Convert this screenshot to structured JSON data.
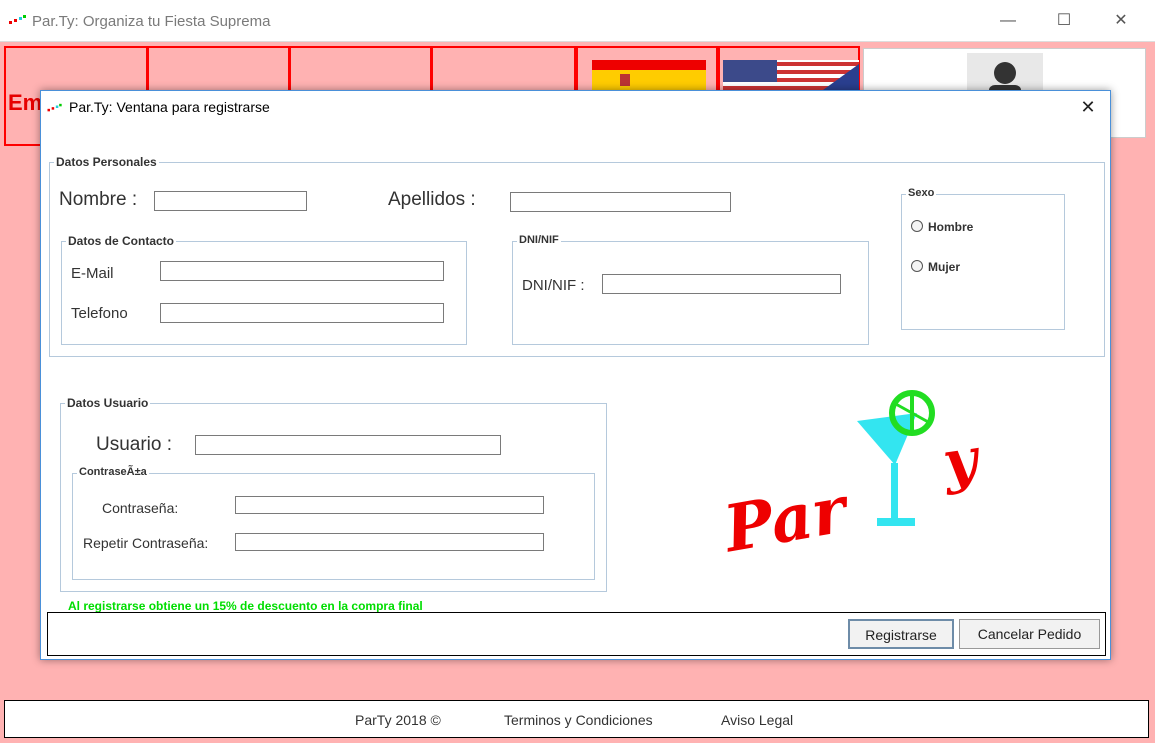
{
  "main_window": {
    "title": "Par.Ty: Organiza tu Fiesta Suprema",
    "top_buttons": [
      "Em",
      "",
      "",
      ""
    ]
  },
  "footer": {
    "copyright": "ParTy 2018 ©",
    "terms": "Terminos y Condiciones",
    "legal": "Aviso Legal"
  },
  "dialog": {
    "title": "Par.Ty: Ventana para registrarse",
    "personal": {
      "legend": "Datos Personales",
      "nombre_label": "Nombre :",
      "apellidos_label": "Apellidos :",
      "contacto": {
        "legend": "Datos de Contacto",
        "email_label": "E-Mail",
        "telefono_label": "Telefono"
      },
      "dni": {
        "legend": "DNI/NIF",
        "dni_label": "DNI/NIF :"
      },
      "sexo": {
        "legend": "Sexo",
        "hombre": "Hombre",
        "mujer": "Mujer"
      }
    },
    "usuario": {
      "legend": "Datos Usuario",
      "usuario_label": "Usuario :",
      "password_group": {
        "legend": "ContraseÃ±a",
        "password_label": "Contraseña:",
        "repeat_label": "Repetir Contraseña:"
      }
    },
    "logo_text": "Par y",
    "promo": "Al registrarse obtiene un 15% de descuento en la compra final",
    "buttons": {
      "register": "Registrarse",
      "cancel": "Cancelar Pedido"
    }
  },
  "colors": {
    "background_pink": "#ffb2b2",
    "accent_red": "#ff0000",
    "promo_green": "#00dd00",
    "logo_cyan": "#33e5f0"
  }
}
